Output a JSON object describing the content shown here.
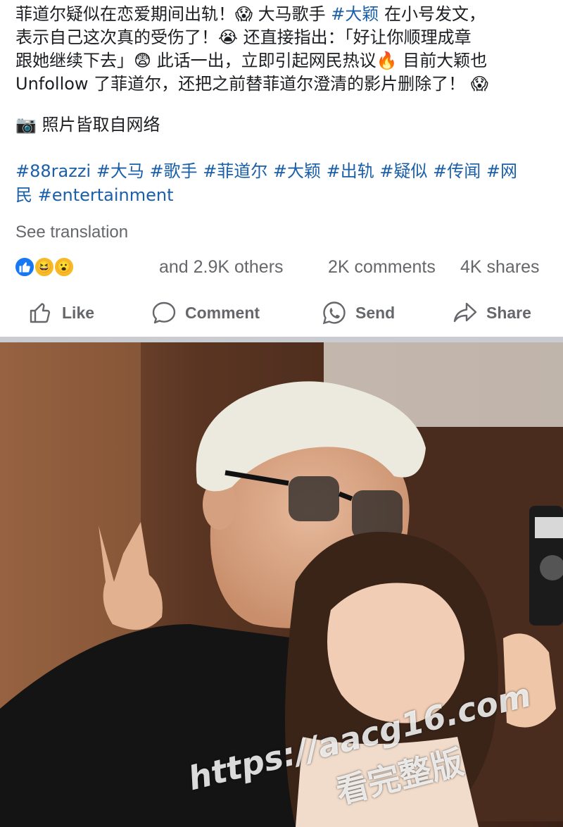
{
  "post": {
    "lines": [
      {
        "a": "菲道尔疑似在恋爱期间出轨！",
        "e1": "😱",
        "b": " 大马歌手 ",
        "tag": "#大颖",
        "c": " 在小号发文，"
      },
      {
        "a": "表示自己这次真的受伤了！",
        "e1": "😭",
        "b": " 还直接指出：「好让你顺理成章"
      },
      {
        "a": "跟她继续下去」",
        "e1": "😨",
        "b": " 此话一出，立即引起网民热议",
        "e2": "🔥",
        "c": " 目前大颖也"
      },
      {
        "a": "Unfollow 了菲道尔，还把之前替菲道尔澄清的影片删除了！",
        "e1": "😱"
      }
    ],
    "photo_note": {
      "icon": "📷",
      "text": " 照片皆取自网络"
    },
    "hashtags_line1": "#88razzi #大马 #歌手 #菲道尔 #大颖 #出轨 #疑似 #传闻 #网",
    "hashtags_line2": "民 #entertainment",
    "see_translation": "See translation"
  },
  "reactions": {
    "icons": [
      "like-reaction-icon",
      "haha-reaction-icon",
      "wow-reaction-icon"
    ],
    "haha_glyph": "😆",
    "wow_glyph": "😮",
    "others_text": "and 2.9K others",
    "comments_text": "2K comments",
    "shares_text": "4K shares"
  },
  "actions": {
    "like": "Like",
    "comment": "Comment",
    "send": "Send",
    "share": "Share"
  },
  "watermark": {
    "url": "https://aacg16.com",
    "sub": "看完整版"
  },
  "colors": {
    "hashtag": "#1a5fa8",
    "meta_text": "#65676b",
    "like_blue": "#1877f2",
    "divider": "#c9ccd1"
  }
}
